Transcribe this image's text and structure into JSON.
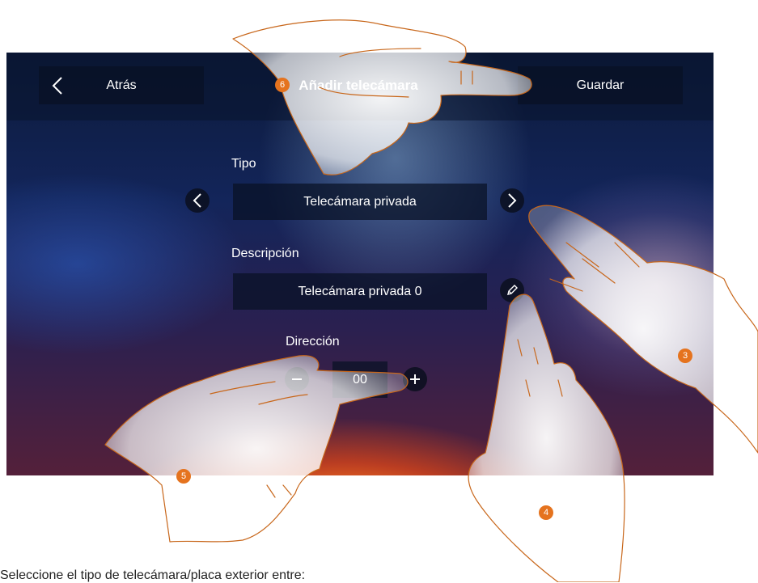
{
  "header": {
    "back_label": "Atrás",
    "title": "Añadir telecámara",
    "save_label": "Guardar"
  },
  "form": {
    "type_label": "Tipo",
    "type_value": "Telecámara privada",
    "description_label": "Descripción",
    "description_value": "Telecámara privada 0",
    "address_label": "Dirección",
    "address_value": "00"
  },
  "callouts": [
    "6",
    "3",
    "4",
    "5"
  ],
  "caption": "Seleccione el tipo de telecámara/placa exterior entre:",
  "colors": {
    "badge": "#e5731e",
    "field_bg": "#0a1530",
    "finger_outline": "#c8671b"
  }
}
